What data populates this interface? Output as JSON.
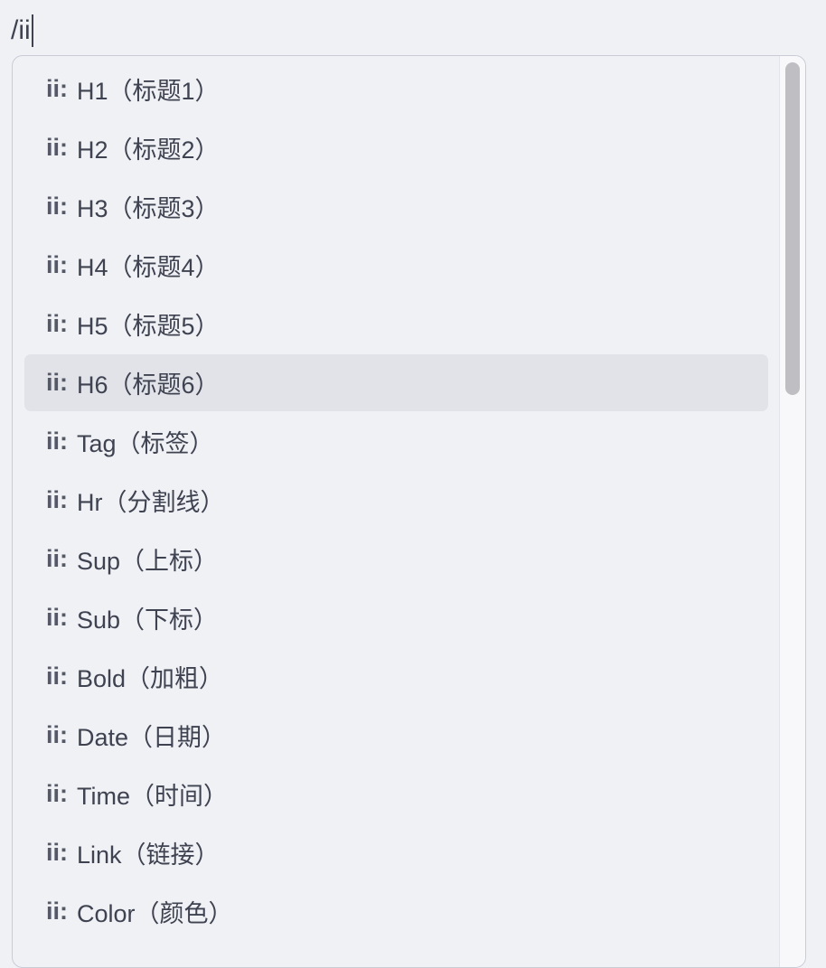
{
  "editor": {
    "typed_text": "/ii"
  },
  "popup": {
    "selected_index": 5,
    "items": [
      {
        "prefix": "ii:",
        "label": "H1（标题1）"
      },
      {
        "prefix": "ii:",
        "label": "H2（标题2）"
      },
      {
        "prefix": "ii:",
        "label": "H3（标题3）"
      },
      {
        "prefix": "ii:",
        "label": "H4（标题4）"
      },
      {
        "prefix": "ii:",
        "label": "H5（标题5）"
      },
      {
        "prefix": "ii:",
        "label": "H6（标题6）"
      },
      {
        "prefix": "ii:",
        "label": "Tag（标签）"
      },
      {
        "prefix": "ii:",
        "label": "Hr（分割线）"
      },
      {
        "prefix": "ii:",
        "label": "Sup（上标）"
      },
      {
        "prefix": "ii:",
        "label": "Sub（下标）"
      },
      {
        "prefix": "ii:",
        "label": "Bold（加粗）"
      },
      {
        "prefix": "ii:",
        "label": "Date（日期）"
      },
      {
        "prefix": "ii:",
        "label": "Time（时间）"
      },
      {
        "prefix": "ii:",
        "label": "Link（链接）"
      },
      {
        "prefix": "ii:",
        "label": "Color（颜色）"
      }
    ]
  }
}
